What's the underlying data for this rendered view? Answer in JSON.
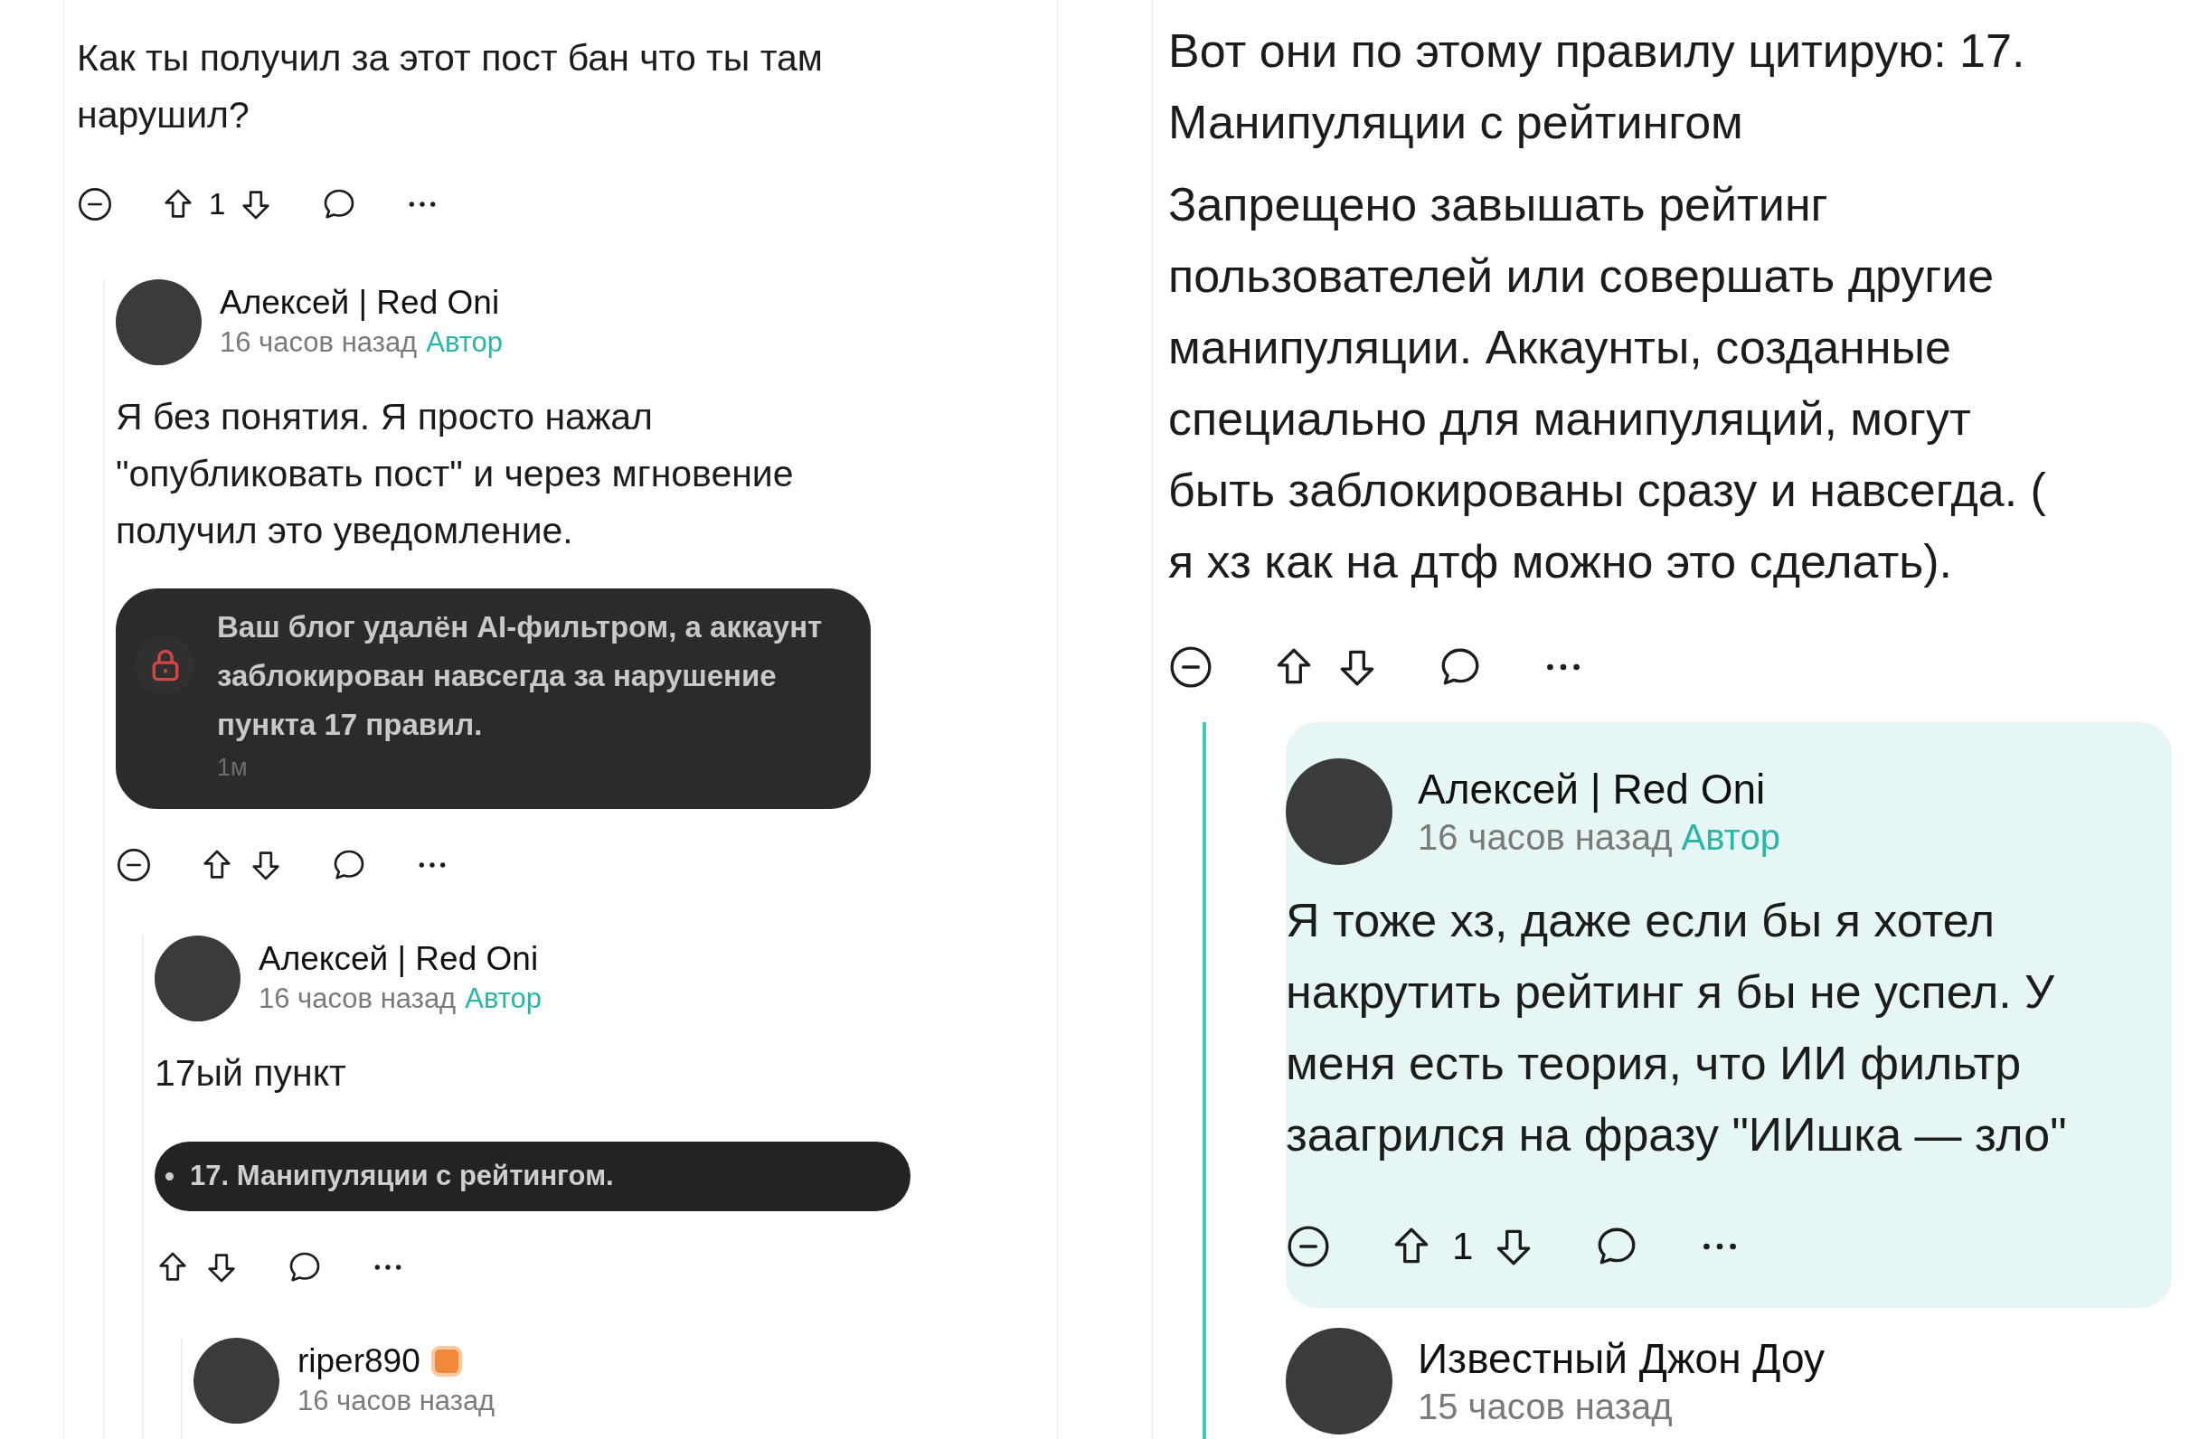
{
  "panels": [
    {
      "thread": {
        "body": [
          "Как ты получил за этот пост бан что ты там нарушил?"
        ],
        "actions": {
          "collapse": true,
          "votes": "1"
        },
        "children": [
          {
            "author": "Алексей | Red Oni",
            "time": "16 часов назад",
            "role": "Автор",
            "body": [
              "Я без понятия. Я просто нажал \"опубликовать пост\" и через мгновение получил это уведомление."
            ],
            "attachment": {
              "kind": "notification",
              "text": "Ваш блог удалён AI-фильтром, а аккаунт заблокирован навсегда за нарушение пункта 17 правил.",
              "time": "1м"
            },
            "actions": {
              "collapse": true
            },
            "children": [
              {
                "author": "Алексей | Red Oni",
                "time": "16 часов назад",
                "role": "Автор",
                "body": [
                  "17ый пункт"
                ],
                "attachment": {
                  "kind": "rule",
                  "text": "17. Манипуляции с рейтингом."
                },
                "actions": {
                  "collapse": false
                },
                "children": [
                  {
                    "author": "riper890",
                    "badge": true,
                    "time": "16 часов назад"
                  }
                ]
              }
            ]
          }
        ]
      }
    },
    {
      "thread": {
        "body": [
          "Вот они по этому правилу цитирую: 17. Манипуляции с рейтингом",
          "Запрещено завышать рейтинг пользователей или совершать другие манипуляции. Аккаунты, созданные специально для манипуляций, могут быть заблокированы сразу и навсегда. ( я хз как на дтф можно это сделать)."
        ],
        "actions": {
          "collapse": true
        },
        "children": [
          {
            "highlighted": true,
            "author": "Алексей | Red Oni",
            "time": "16 часов назад",
            "role": "Автор",
            "body": [
              "Я тоже хз, даже если бы я хотел накрутить рейтинг я бы не успел. У меня есть теория, что ИИ фильтр заагрился на фразу \"ИИшка — зло\""
            ],
            "actions": {
              "collapse": true,
              "votes": "1"
            }
          },
          {
            "highlighted": false,
            "author": "Известный Джон Доу",
            "time": "15 часов назад"
          }
        ]
      }
    }
  ]
}
